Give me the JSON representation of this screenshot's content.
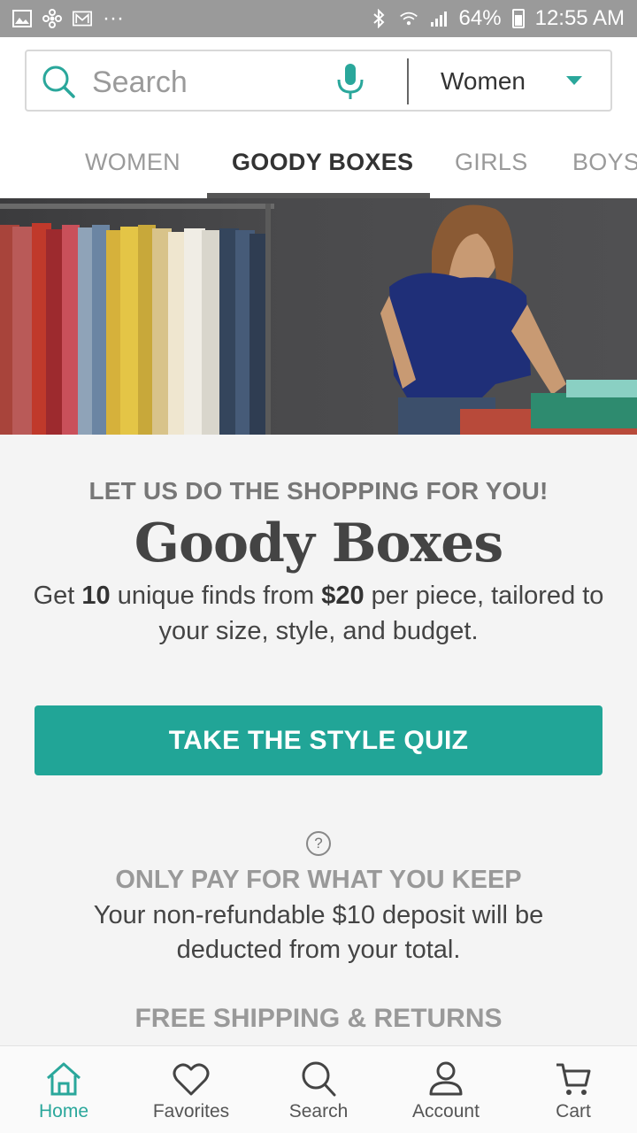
{
  "status_bar": {
    "battery": "64%",
    "time": "12:55 AM",
    "overflow": "···"
  },
  "search": {
    "placeholder": "Search",
    "gender": "Women"
  },
  "tabs": [
    {
      "label": "WOMEN",
      "active": false
    },
    {
      "label": "GOODY BOXES",
      "active": true
    },
    {
      "label": "GIRLS",
      "active": false
    },
    {
      "label": "BOYS",
      "active": false
    }
  ],
  "content": {
    "tagline": "LET US DO THE SHOPPING FOR YOU!",
    "title": "Goody Boxes",
    "desc_prefix": "Get ",
    "desc_count": "10",
    "desc_middle": " unique finds from ",
    "desc_price": "$20",
    "desc_suffix": " per piece, tailored to your size, style, and budget.",
    "cta_label": "TAKE THE STYLE QUIZ",
    "help_glyph": "?",
    "pay_title": "ONLY PAY FOR WHAT YOU KEEP",
    "pay_desc": "Your non-refundable $10 deposit will be deducted from your total.",
    "ship_title": "FREE SHIPPING & RETURNS"
  },
  "bottom_nav": [
    {
      "label": "Home",
      "icon": "home-icon",
      "active": true
    },
    {
      "label": "Favorites",
      "icon": "heart-icon",
      "active": false
    },
    {
      "label": "Search",
      "icon": "search-icon",
      "active": false
    },
    {
      "label": "Account",
      "icon": "account-icon",
      "active": false
    },
    {
      "label": "Cart",
      "icon": "cart-icon",
      "active": false
    }
  ],
  "colors": {
    "accent": "#21a597",
    "status_bar": "#9a9a9a",
    "text_dark": "#444444",
    "text_muted": "#999999"
  }
}
